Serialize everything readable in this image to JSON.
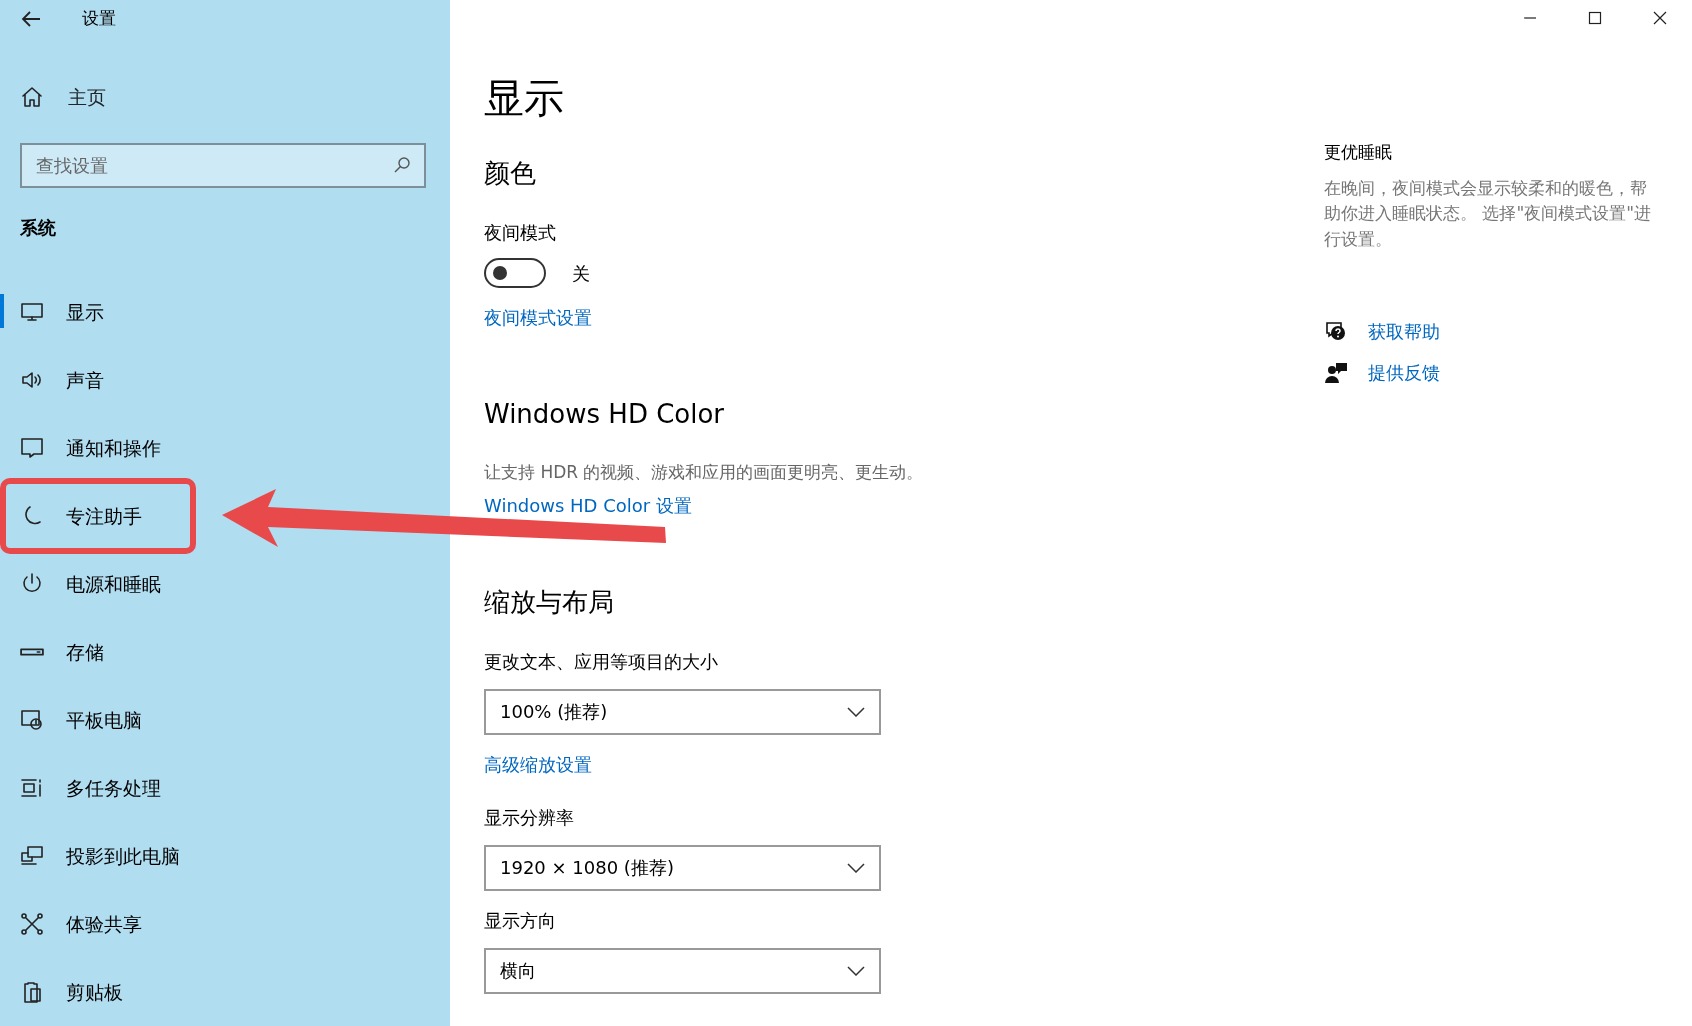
{
  "window": {
    "title": "设置"
  },
  "sidebar": {
    "home": "主页",
    "search": {
      "placeholder": "查找设置"
    },
    "section": "系统",
    "items": [
      {
        "label": "显示",
        "selected": true,
        "annotated": false
      },
      {
        "label": "声音",
        "selected": false,
        "annotated": false
      },
      {
        "label": "通知和操作",
        "selected": false,
        "annotated": false
      },
      {
        "label": "专注助手",
        "selected": false,
        "annotated": true
      },
      {
        "label": "电源和睡眠",
        "selected": false,
        "annotated": false
      },
      {
        "label": "存储",
        "selected": false,
        "annotated": false
      },
      {
        "label": "平板电脑",
        "selected": false,
        "annotated": false
      },
      {
        "label": "多任务处理",
        "selected": false,
        "annotated": false
      },
      {
        "label": "投影到此电脑",
        "selected": false,
        "annotated": false
      },
      {
        "label": "体验共享",
        "selected": false,
        "annotated": false
      },
      {
        "label": "剪贴板",
        "selected": false,
        "annotated": false
      }
    ]
  },
  "main": {
    "title": "显示",
    "sections": [
      {
        "heading": "颜色",
        "items": [
          {
            "kind": "label",
            "text": "夜间模式"
          },
          {
            "kind": "toggle",
            "on": false,
            "state_text": "关"
          },
          {
            "kind": "link",
            "text": "夜间模式设置"
          }
        ]
      },
      {
        "heading": "Windows HD Color",
        "items": [
          {
            "kind": "desc",
            "text": "让支持 HDR 的视频、游戏和应用的画面更明亮、更生动。"
          },
          {
            "kind": "link",
            "text": "Windows HD Color 设置"
          }
        ]
      },
      {
        "heading": "缩放与布局",
        "items": [
          {
            "kind": "label",
            "text": "更改文本、应用等项目的大小"
          },
          {
            "kind": "dropdown",
            "value": "100% (推荐)"
          },
          {
            "kind": "link",
            "text": "高级缩放设置"
          },
          {
            "kind": "label",
            "text": "显示分辨率"
          },
          {
            "kind": "dropdown",
            "value": "1920 × 1080 (推荐)"
          },
          {
            "kind": "label",
            "text": "显示方向"
          },
          {
            "kind": "dropdown",
            "value": "横向"
          }
        ]
      }
    ]
  },
  "aside": {
    "heading": "更优睡眠",
    "text": "在晚间，夜间模式会显示较柔和的暖色，帮助你进入睡眠状态。 选择\"夜间模式设置\"进行设置。",
    "links": [
      {
        "text": "获取帮助"
      },
      {
        "text": "提供反馈"
      }
    ]
  }
}
